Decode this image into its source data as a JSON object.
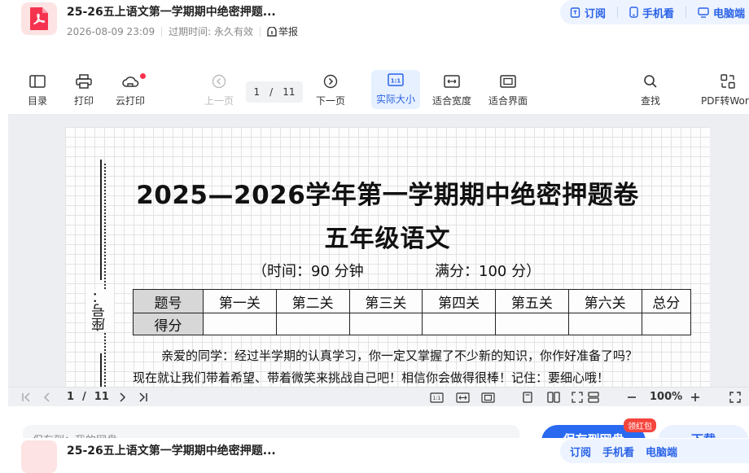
{
  "header": {
    "title": "25-26五上语文第一学期期中绝密押题...",
    "date": "2026-08-09 23:09",
    "expiry_label": "过期时间:",
    "expiry_value": "永久有效",
    "report": "举报",
    "actions": [
      {
        "label": "订阅",
        "icon": "bookmark-icon"
      },
      {
        "label": "手机看",
        "icon": "phone-icon"
      },
      {
        "label": "电脑端",
        "icon": "monitor-icon"
      }
    ]
  },
  "toolbar": {
    "toc": "目录",
    "print": "打印",
    "cloud_print": "云打印",
    "prev_page": "上一页",
    "current_page": "1",
    "separator": "/",
    "total_pages": "11",
    "next_page": "下一页",
    "actual_size": "实际大小",
    "fit_width": "适合宽度",
    "fit_page": "适合界面",
    "search": "查找",
    "pdf_to_word": "PDF转Word"
  },
  "document": {
    "title": "2025—2026学年第一学期期中绝密押题卷",
    "subtitle": "五年级语文",
    "time": "（时间：90 分钟",
    "full_score": "满分：100 分）",
    "seat": "座号：",
    "table_headers": [
      "题号",
      "第一关",
      "第二关",
      "第三关",
      "第四关",
      "第五关",
      "第六关",
      "总分"
    ],
    "table_row": [
      "得分",
      "",
      "",
      "",
      "",
      "",
      "",
      ""
    ],
    "intro_line1": "亲爱的同学：经过半学期的认真学习，你一定又掌握了不少新的知识，你作好准备了吗？",
    "intro_line2": "现在就让我们带着希望、带着微笑来挑战自己吧！相信你会做得很棒！记住：要细心哦！"
  },
  "viewer_bar": {
    "page": "1",
    "separator": "/",
    "total": "11",
    "zoom": "100%"
  },
  "footer": {
    "save_to": "保存到：我的网盘",
    "save_button": "保存到网盘",
    "red_packet": "领红包",
    "download": "下载"
  },
  "colors": {
    "accent": "#2a62e8",
    "pdf_red": "#f5334f",
    "table_header_bg": "#d7d7d7"
  }
}
